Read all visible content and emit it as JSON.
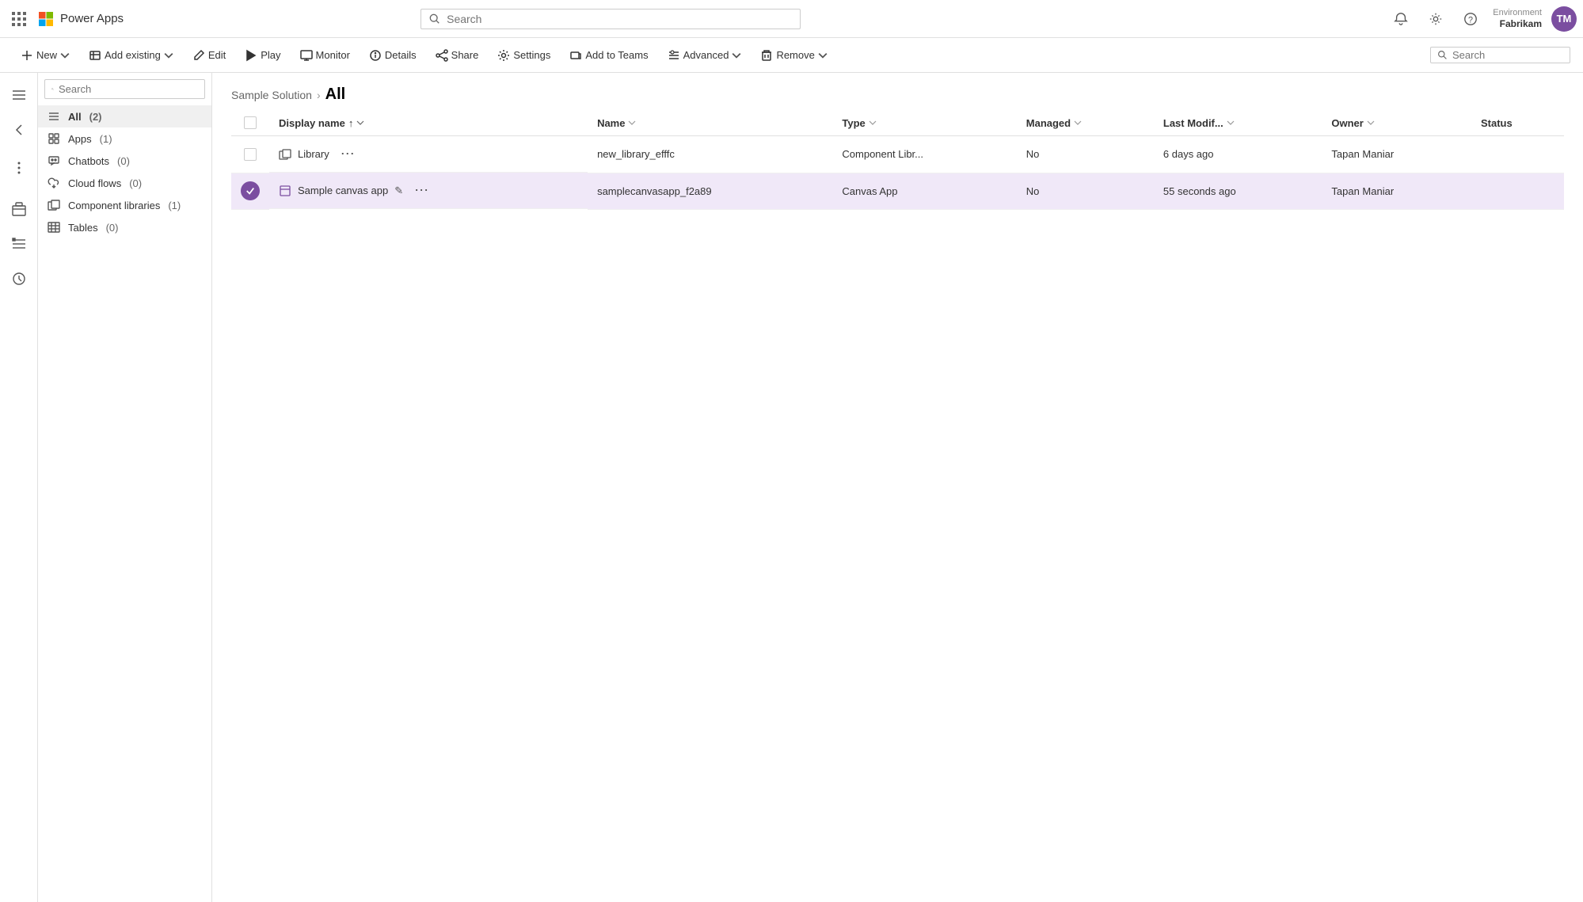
{
  "topbar": {
    "app_name": "Power Apps",
    "search_placeholder": "Search",
    "environment_label": "Environment",
    "environment_name": "Fabrikam",
    "avatar_initials": "TM"
  },
  "commandbar": {
    "new_label": "New",
    "add_existing_label": "Add existing",
    "edit_label": "Edit",
    "play_label": "Play",
    "monitor_label": "Monitor",
    "details_label": "Details",
    "share_label": "Share",
    "settings_label": "Settings",
    "add_to_teams_label": "Add to Teams",
    "advanced_label": "Advanced",
    "remove_label": "Remove",
    "search_placeholder": "Search"
  },
  "sidebar": {
    "search_placeholder": "Search",
    "items": [
      {
        "id": "all",
        "label": "All",
        "count": "(2)",
        "active": true
      },
      {
        "id": "apps",
        "label": "Apps",
        "count": "(1)",
        "active": false
      },
      {
        "id": "chatbots",
        "label": "Chatbots",
        "count": "(0)",
        "active": false
      },
      {
        "id": "cloud-flows",
        "label": "Cloud flows",
        "count": "(0)",
        "active": false
      },
      {
        "id": "component-libraries",
        "label": "Component libraries",
        "count": "(1)",
        "active": false
      },
      {
        "id": "tables",
        "label": "Tables",
        "count": "(0)",
        "active": false
      }
    ]
  },
  "breadcrumb": {
    "parent": "Sample Solution",
    "current": "All"
  },
  "table": {
    "columns": [
      {
        "id": "display-name",
        "label": "Display name",
        "sort": "asc"
      },
      {
        "id": "name",
        "label": "Name",
        "sort": "none"
      },
      {
        "id": "type",
        "label": "Type",
        "sort": "none"
      },
      {
        "id": "managed",
        "label": "Managed",
        "sort": "none"
      },
      {
        "id": "last-modified",
        "label": "Last Modif...",
        "sort": "none"
      },
      {
        "id": "owner",
        "label": "Owner",
        "sort": "none"
      },
      {
        "id": "status",
        "label": "Status",
        "sort": "none"
      }
    ],
    "rows": [
      {
        "id": "row-library",
        "display_name": "Library",
        "name": "new_library_efffc",
        "type": "Component Libr...",
        "managed": "No",
        "last_modified": "6 days ago",
        "owner": "Tapan Maniar",
        "status": "",
        "selected": false
      },
      {
        "id": "row-sample-canvas",
        "display_name": "Sample canvas app",
        "name": "samplecanvasapp_f2a89",
        "type": "Canvas App",
        "managed": "No",
        "last_modified": "55 seconds ago",
        "owner": "Tapan Maniar",
        "status": "",
        "selected": true
      }
    ]
  }
}
